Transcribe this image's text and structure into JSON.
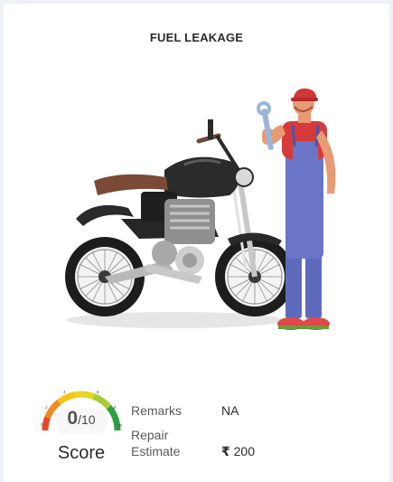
{
  "card": {
    "title": "FUEL LEAKAGE"
  },
  "illustration": {
    "subject": "motorcycle-and-mechanic"
  },
  "score": {
    "value": "0",
    "max": "/10",
    "label": "Score",
    "gauge_ticks": [
      "0",
      "2",
      "4",
      "6",
      "8",
      "10"
    ],
    "gauge_colors": [
      "#e8482b",
      "#f08a24",
      "#f5c518",
      "#c9d92a",
      "#7cc242",
      "#2e9e44"
    ]
  },
  "details": {
    "remarks_label": "Remarks",
    "remarks_value": "NA",
    "repair_label": "Repair Estimate",
    "currency_symbol": "₹",
    "repair_value": "200"
  }
}
